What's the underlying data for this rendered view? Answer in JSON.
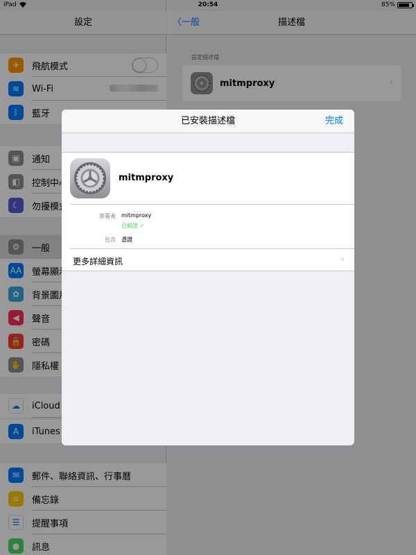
{
  "status_bar": {
    "device": "iPad",
    "time": "20:54",
    "battery": "85%",
    "battery_level": 0.85
  },
  "settings": {
    "title": "設定",
    "items": [
      {
        "label": "飛航模式",
        "icon": "airplane-icon",
        "color": "#ff9500"
      },
      {
        "label": "Wi-Fi",
        "icon": "wifi-icon",
        "color": "#007aff"
      },
      {
        "label": "藍牙",
        "icon": "bluetooth-icon",
        "color": "#007aff"
      },
      {
        "label": "通知",
        "icon": "notifications-icon",
        "color": "#8e8e93"
      },
      {
        "label": "控制中心",
        "icon": "control-center-icon",
        "color": "#8e8e93"
      },
      {
        "label": "勿擾模式",
        "icon": "moon-icon",
        "color": "#5856d6"
      },
      {
        "label": "一般",
        "icon": "gear-icon",
        "color": "#8e8e93"
      },
      {
        "label": "螢幕顯示",
        "icon": "display-icon",
        "color": "#007aff"
      },
      {
        "label": "背景圖片",
        "icon": "wallpaper-icon",
        "color": "#34aadc"
      },
      {
        "label": "聲音",
        "icon": "sound-icon",
        "color": "#ff2d55"
      },
      {
        "label": "密碼",
        "icon": "lock-icon",
        "color": "#ff3b30"
      },
      {
        "label": "隱私權",
        "icon": "hand-icon",
        "color": "#8e8e93"
      },
      {
        "label": "iCloud",
        "icon": "cloud-icon",
        "color": "#ffffff"
      },
      {
        "label": "iTunes",
        "icon": "app-store-icon",
        "color": "#007aff"
      },
      {
        "label": "郵件、聯絡資訊、行事曆",
        "icon": "mail-icon",
        "color": "#007aff"
      },
      {
        "label": "備忘錄",
        "icon": "notes-icon",
        "color": "#ffcc00"
      },
      {
        "label": "提醒事項",
        "icon": "reminders-icon",
        "color": "#ffffff"
      },
      {
        "label": "訊息",
        "icon": "messages-icon",
        "color": "#4cd964"
      }
    ],
    "airplane_mode_on": false
  },
  "detail": {
    "back_label": "一般",
    "title": "描述檔",
    "section_header": "設定描述檔",
    "profile_name": "mitmproxy"
  },
  "modal": {
    "title": "已安裝描述檔",
    "done_label": "完成",
    "profile_name": "mitmproxy",
    "signed_by_label": "簽署者",
    "signed_by_value": "mitmproxy",
    "verified_label": "已驗證 ✓",
    "contains_label": "包含",
    "contains_value": "憑證",
    "more_details_label": "更多詳細資訊"
  },
  "colors": {
    "accent": "#007aff",
    "verified": "#4cd964"
  }
}
